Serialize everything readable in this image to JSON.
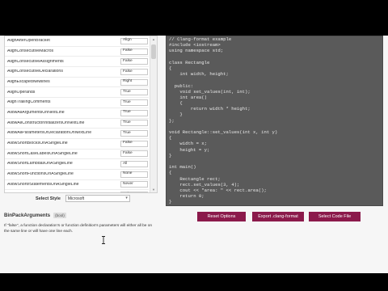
{
  "options": [
    {
      "name": "AlignAfterOpenBracket",
      "value": "Align"
    },
    {
      "name": "AlignConsecutiveMacros",
      "value": "False"
    },
    {
      "name": "AlignConsecutiveAssignments",
      "value": "False"
    },
    {
      "name": "AlignConsecutiveDeclarations",
      "value": "False"
    },
    {
      "name": "AlignEscapedNewlines",
      "value": "Right"
    },
    {
      "name": "AlignOperands",
      "value": "True"
    },
    {
      "name": "AlignTrailingComments",
      "value": "True"
    },
    {
      "name": "AllowAllArgumentsOnNextLine",
      "value": "True"
    },
    {
      "name": "AllowAllConstructorInitializersOnNextLine",
      "value": "True"
    },
    {
      "name": "AllowAllParametersOfDeclarationOnNextLine",
      "value": "True"
    },
    {
      "name": "AllowShortBlocksOnASingleLine",
      "value": "False"
    },
    {
      "name": "AllowShortCaseLabelsOnASingleLine",
      "value": "False"
    },
    {
      "name": "AllowShortLambdasOnASingleLine",
      "value": "All"
    },
    {
      "name": "AllowShortFunctionsOnASingleLine",
      "value": "None"
    },
    {
      "name": "AllowShortIfStatementsOnASingleLine",
      "value": "Never"
    },
    {
      "name": "AllowShortLoopsOnASingleLine",
      "value": "False"
    },
    {
      "name": "AlwaysBreakAfterReturnType",
      "value": "None"
    },
    {
      "name": "AlwaysBreakBeforeMultilineStrings",
      "value": "True"
    }
  ],
  "style": {
    "label": "Select Style",
    "value": "Microsoft"
  },
  "description": {
    "title": "BinPackArguments",
    "badge": "(bool)",
    "text": "If \"false\", a function declaration's or function definition's parameters will either all be on the same line or will have one line each."
  },
  "code": [
    "// Clang-format example",
    "#include <iostream>",
    "using namespace std;",
    "",
    "class Rectangle",
    "{",
    "    int width, height;",
    "",
    "  public:",
    "    void set_values(int, int);",
    "    int area()",
    "    {",
    "        return width * height;",
    "    }",
    "};",
    "",
    "void Rectangle::set_values(int x, int y)",
    "{",
    "    width = x;",
    "    height = y;",
    "}",
    "",
    "int main()",
    "{",
    "    Rectangle rect;",
    "    rect.set_values(3, 4);",
    "    cout << \"area: \" << rect.area();",
    "    return 0;",
    "}"
  ],
  "buttons": {
    "reset": "Reset Options",
    "export": "Export .clang-format",
    "select": "Select Code File"
  },
  "icons": {
    "dropdown": "chevron-down-icon",
    "scroll_up": "arrow-up-icon",
    "scroll_down": "arrow-down-icon",
    "cursor": "text-cursor-icon"
  },
  "colors": {
    "accent": "#8b1a4b",
    "code_bg": "#5a5a5a"
  }
}
